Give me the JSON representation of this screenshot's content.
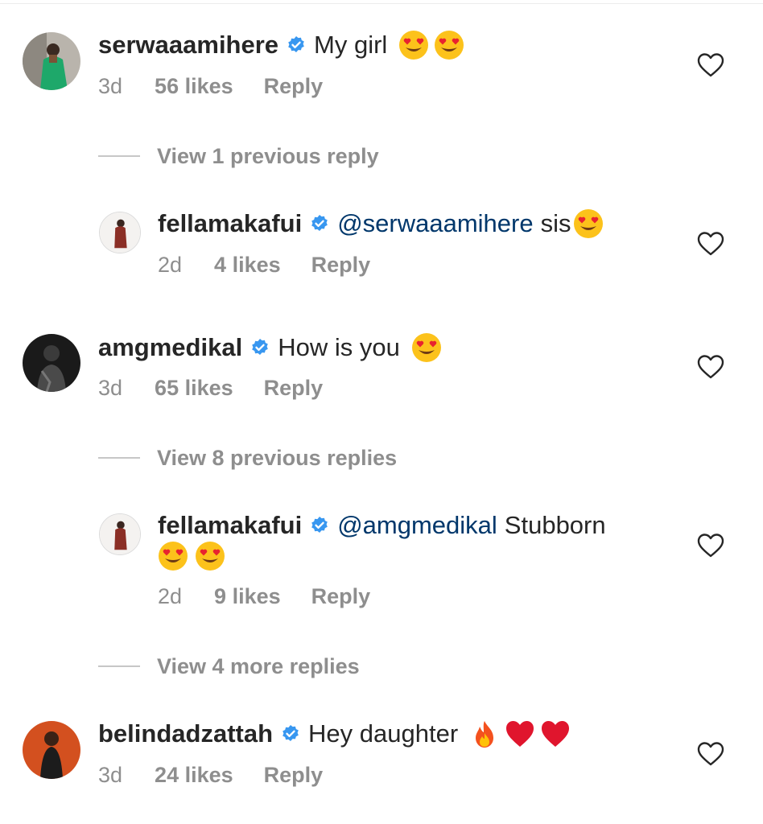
{
  "comments": [
    {
      "username": "serwaaamihere",
      "text": "My girl",
      "emojis": [
        "heart-eyes",
        "heart-eyes"
      ],
      "time": "3d",
      "likes": "56 likes",
      "reply": "Reply"
    },
    {
      "username": "fellamakafui",
      "mention": "@serwaaamihere",
      "text": "sis",
      "emojis": [
        "heart-eyes"
      ],
      "time": "2d",
      "likes": "4 likes",
      "reply": "Reply"
    },
    {
      "username": "amgmedikal",
      "text": "How is you",
      "emojis": [
        "heart-eyes"
      ],
      "time": "3d",
      "likes": "65 likes",
      "reply": "Reply"
    },
    {
      "username": "fellamakafui",
      "mention": "@amgmedikal",
      "text": "Stubborn",
      "emojis": [
        "heart-eyes",
        "heart-eyes"
      ],
      "time": "2d",
      "likes": "9 likes",
      "reply": "Reply"
    },
    {
      "username": "belindadzattah",
      "text": "Hey daughter",
      "emojis": [
        "fire",
        "red-heart",
        "red-heart"
      ],
      "time": "3d",
      "likes": "24 likes",
      "reply": "Reply"
    }
  ],
  "view_links": {
    "previous_1": "View 1 previous reply",
    "previous_8": "View 8 previous replies",
    "more_4": "View 4 more replies"
  },
  "colors": {
    "verified": "#3897f0",
    "mention": "#00376b",
    "meta": "#8e8e8e",
    "text": "#262626"
  }
}
